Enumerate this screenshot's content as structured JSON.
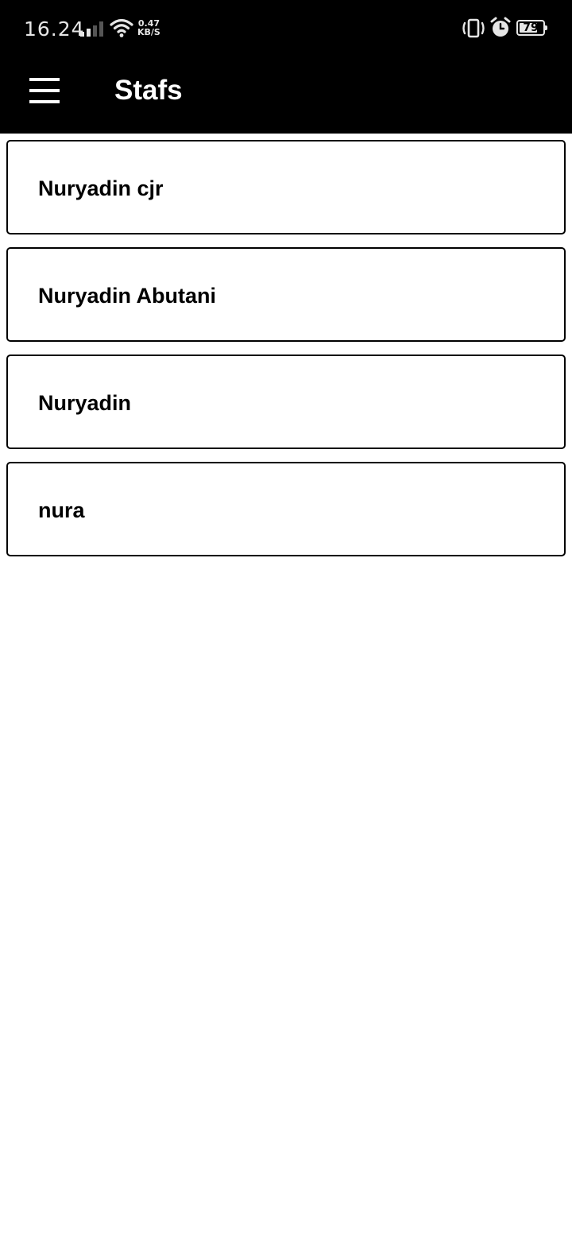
{
  "status_bar": {
    "time": "16.24",
    "net_speed_value": "0.47",
    "net_speed_unit": "KB/S",
    "battery_level": "79",
    "battery_fraction": 0.79,
    "icons": [
      "signal-icon",
      "wifi-icon",
      "vibrate-icon",
      "alarm-icon",
      "battery-icon"
    ]
  },
  "app_bar": {
    "menu_icon": "hamburger-menu-icon",
    "title": "Stafs",
    "background": "#000000"
  },
  "stafs": [
    {
      "name": "Nuryadin cjr"
    },
    {
      "name": "Nuryadin Abutani"
    },
    {
      "name": "Nuryadin"
    },
    {
      "name": "nura"
    }
  ]
}
